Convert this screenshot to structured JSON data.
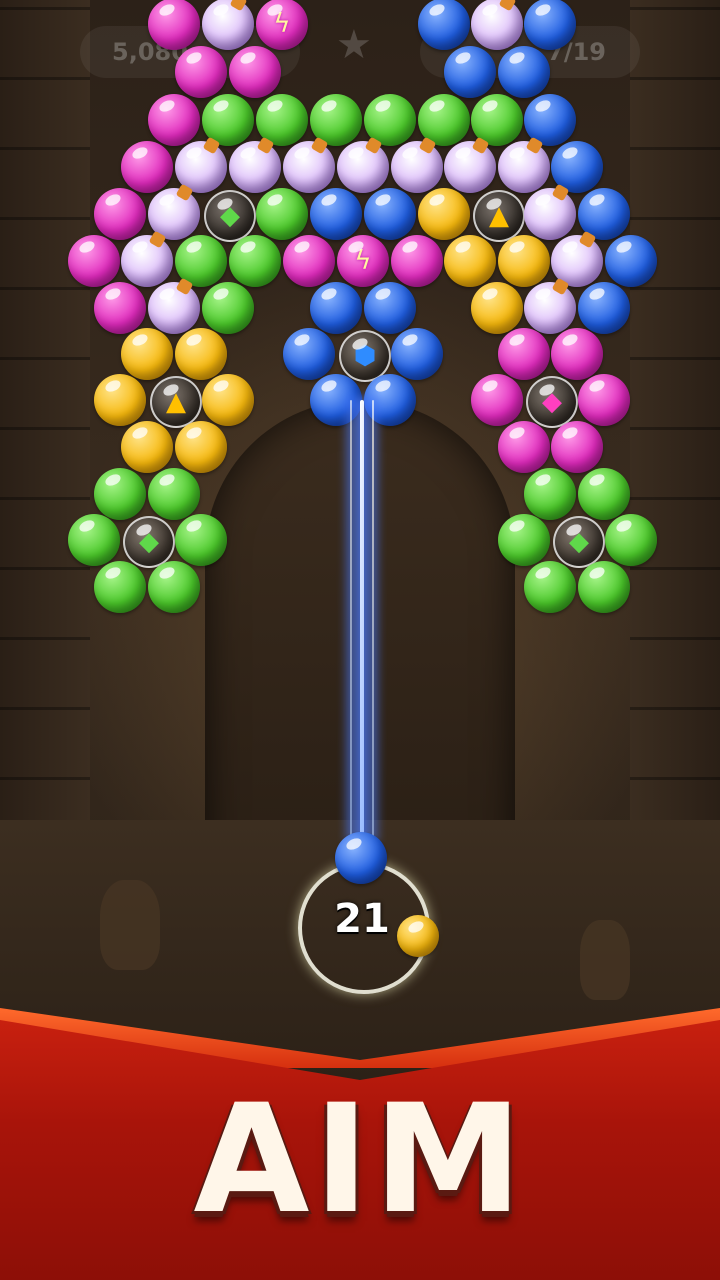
{
  "hud": {
    "score": "5,080",
    "level_progress": "7/19",
    "star_icon": "star-icon"
  },
  "shooter": {
    "shots_remaining": "21",
    "current_bubble_color": "blue",
    "next_bubble_color": "yellow"
  },
  "banner": {
    "title": "AIM"
  },
  "colors": {
    "pink": "#e02bbd",
    "green": "#4bc82a",
    "blue": "#1f5de0",
    "yellow": "#f6b80d",
    "banner_red": "#b5170b",
    "aim_line": "#4c7dff"
  }
}
